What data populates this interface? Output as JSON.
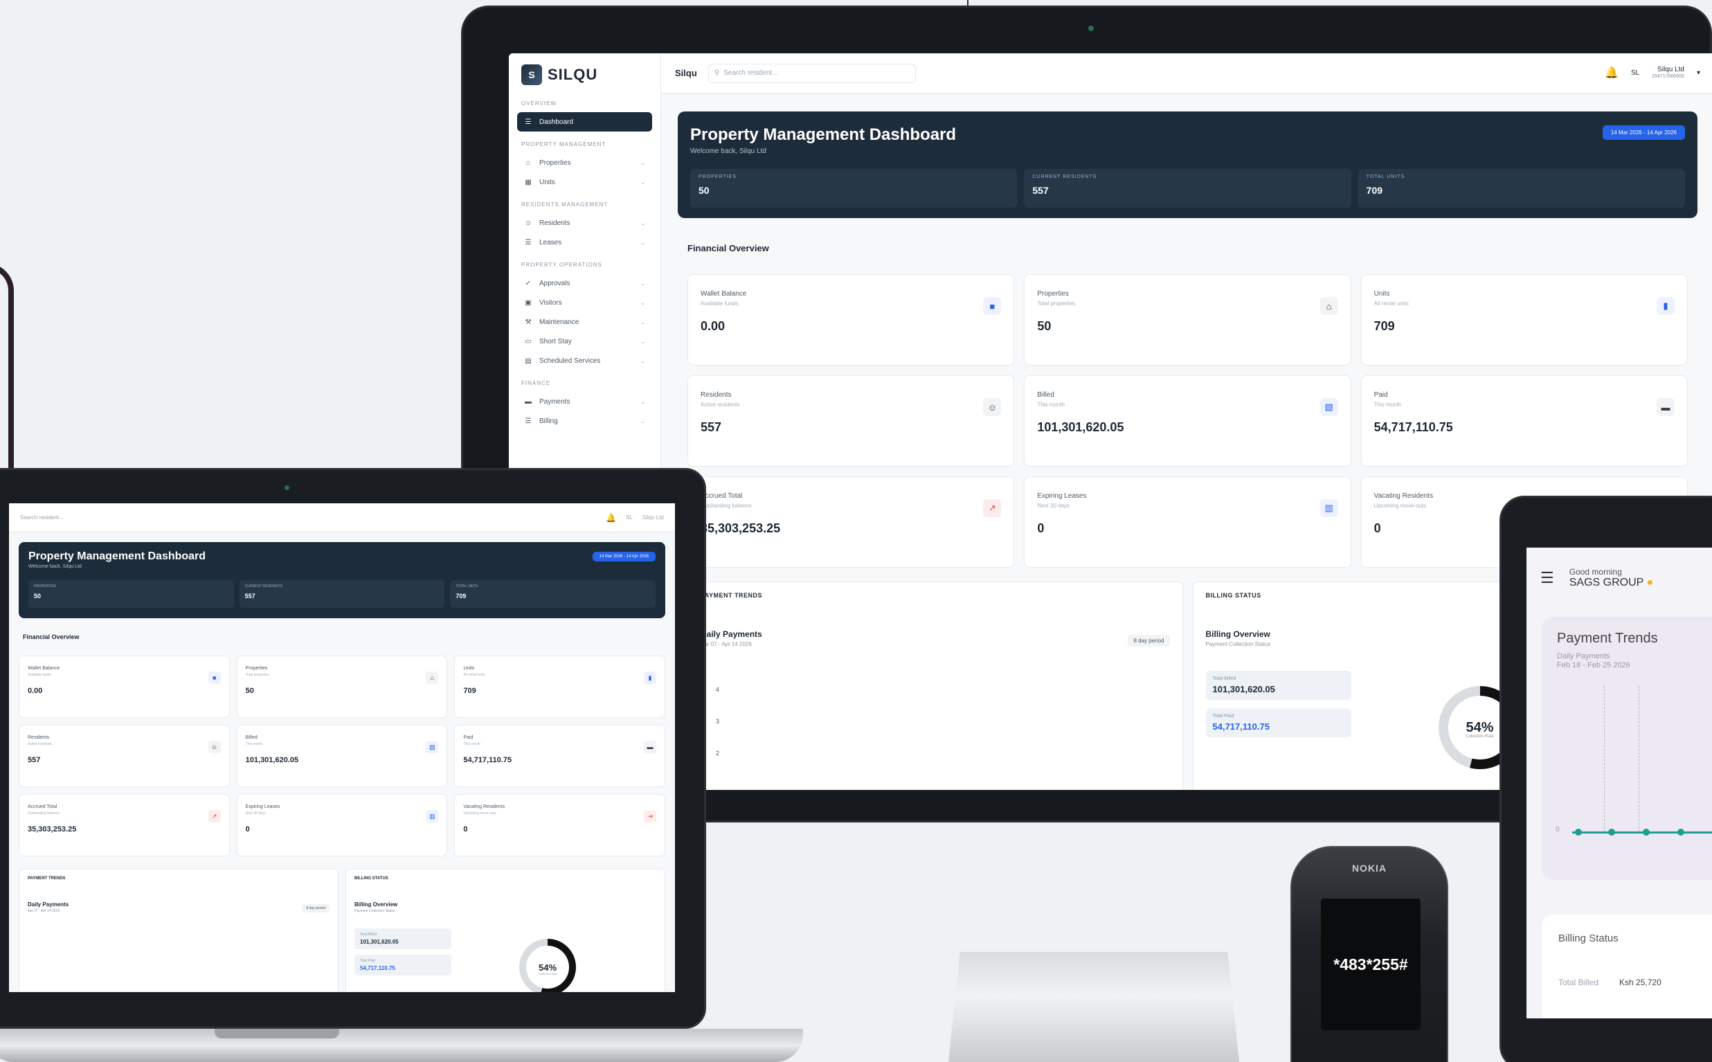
{
  "monitor": {
    "logo": "SILQU",
    "brand": "Silqu",
    "search_placeholder": "Search resident...",
    "user_name": "Silqu Ltd",
    "user_sub": "254717000000",
    "user_initials": "SL",
    "sidebar": {
      "sections": [
        {
          "title": "OVERVIEW",
          "items": [
            {
              "label": "Dashboard",
              "icon": "menu-icon",
              "active": true
            }
          ]
        },
        {
          "title": "PROPERTY MANAGEMENT",
          "items": [
            {
              "label": "Properties",
              "icon": "home-icon"
            },
            {
              "label": "Units",
              "icon": "grid-icon"
            }
          ]
        },
        {
          "title": "RESIDENTS MANAGEMENT",
          "items": [
            {
              "label": "Residents",
              "icon": "users-icon"
            },
            {
              "label": "Leases",
              "icon": "file-icon"
            }
          ]
        },
        {
          "title": "PROPERTY OPERATIONS",
          "items": [
            {
              "label": "Approvals",
              "icon": "user-check-icon"
            },
            {
              "label": "Visitors",
              "icon": "id-icon"
            },
            {
              "label": "Maintenance",
              "icon": "wrench-icon"
            },
            {
              "label": "Short Stay",
              "icon": "bed-icon"
            },
            {
              "label": "Scheduled Services",
              "icon": "calendar-icon"
            }
          ]
        },
        {
          "title": "FINANCE",
          "items": [
            {
              "label": "Payments",
              "icon": "card-icon"
            },
            {
              "label": "Billing",
              "icon": "receipt-icon"
            }
          ]
        }
      ]
    },
    "hero": {
      "title": "Property Management Dashboard",
      "subtitle": "Welcome back, Silqu Ltd",
      "date_range": "14 Mar 2026 - 14 Apr 2026",
      "stats": [
        {
          "label": "PROPERTIES",
          "value": "50"
        },
        {
          "label": "CURRENT RESIDENTS",
          "value": "557"
        },
        {
          "label": "TOTAL UNITS",
          "value": "709"
        }
      ]
    },
    "financial_title": "Financial Overview",
    "cards": [
      {
        "label": "Wallet Balance",
        "sub": "Available funds",
        "value": "0.00",
        "icon": "wallet-icon",
        "tone": "blue"
      },
      {
        "label": "Properties",
        "sub": "Total properties",
        "value": "50",
        "icon": "home-icon",
        "tone": "dark"
      },
      {
        "label": "Units",
        "sub": "All rental units",
        "value": "709",
        "icon": "building-icon",
        "tone": "blue"
      },
      {
        "label": "Residents",
        "sub": "Active residents",
        "value": "557",
        "icon": "users-icon",
        "tone": "dark"
      },
      {
        "label": "Billed",
        "sub": "This month",
        "value": "101,301,620.05",
        "icon": "document-icon",
        "tone": "blue"
      },
      {
        "label": "Paid",
        "sub": "This month",
        "value": "54,717,110.75",
        "icon": "money-icon",
        "tone": "dark"
      },
      {
        "label": "Accrued Total",
        "sub": "Outstanding balance",
        "value": "35,303,253.25",
        "icon": "chart-icon",
        "tone": "red"
      },
      {
        "label": "Expiring Leases",
        "sub": "Next 30 days",
        "value": "0",
        "icon": "clipboard-icon",
        "tone": "blue"
      },
      {
        "label": "Vacating Residents",
        "sub": "Upcoming move-outs",
        "value": "0",
        "icon": "exit-icon",
        "tone": "red"
      }
    ],
    "payment_trends": {
      "header": "PAYMENT TRENDS",
      "title": "Daily Payments",
      "subtitle": "Apr 07 - Apr 14 2026",
      "period": "8 day period",
      "axis": [
        "4",
        "3",
        "2"
      ]
    },
    "billing_status": {
      "header": "BILLING STATUS",
      "title": "Billing Overview",
      "subtitle": "Payment Collection Status",
      "billed_label": "Total Billed",
      "billed_value": "101,301,620.05",
      "paid_label": "Total Paid",
      "paid_value": "54,717,110.75",
      "collection_rate": "54%",
      "collection_label": "Collection Rate",
      "collection_fraction": 0.54
    }
  },
  "laptop": {
    "search_placeholder": "Search resident...",
    "hero_title": "Property Management Dashboard",
    "hero_subtitle": "Welcome back, Silqu Ltd",
    "financial_title": "Financial Overview",
    "payment_header": "PAYMENT TRENDS",
    "payment_title": "Daily Payments",
    "payment_sub": "Apr 07 - Apr 14 2026",
    "billing_header": "BILLING STATUS",
    "billing_title": "Billing Overview",
    "billing_sub": "Payment Collection Status"
  },
  "phone": {
    "brand": "NOKIA",
    "ussd_code": "*483*255#"
  },
  "tablet": {
    "greeting": "Good morning",
    "company": "SAGS GROUP",
    "payment_title": "Payment Trends",
    "payment_sub1": "Daily Payments",
    "payment_sub2": "Feb 18 - Feb 25 2026",
    "zero_label": "0",
    "billing_title": "Billing Status",
    "total_billed_label": "Total Billed",
    "total_billed_value": "Ksh 25,720"
  }
}
